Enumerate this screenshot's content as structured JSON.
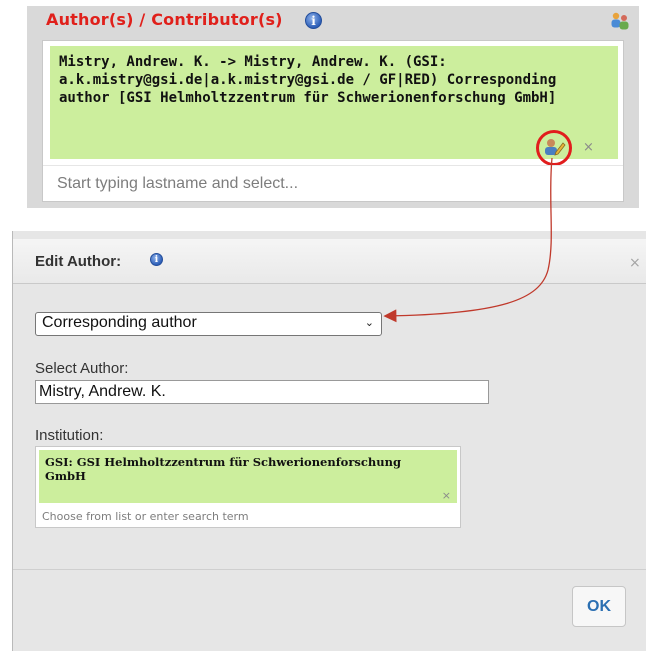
{
  "author_section": {
    "title": "Author(s) / Contributor(s)",
    "info_icon": "info-icon",
    "manage_icon": "people-group-icon",
    "selected_author": {
      "text": "Mistry, Andrew. K. -> Mistry, Andrew. K. (GSI: a.k.mistry@gsi.de|a.k.mistry@gsi.de / GF|RED) Corresponding author [GSI Helmholtzzentrum für Schwerionenforschung GmbH]",
      "edit_icon": "edit-author-icon",
      "remove_label": "×"
    },
    "search_placeholder": "Start typing lastname and select..."
  },
  "dialog": {
    "title": "Edit Author:",
    "close_label": "×",
    "role_select": {
      "selected": "Corresponding author",
      "chevron": "⌄"
    },
    "select_author_label": "Select Author:",
    "author_value": "Mistry, Andrew. K.",
    "institution_label": "Institution:",
    "institution_tag": "GSI: GSI Helmholtzzentrum für Schwerionenforschung GmbH",
    "institution_remove": "×",
    "institution_placeholder": "Choose from list or enter search term",
    "ok_label": "OK"
  },
  "colors": {
    "title_red": "#e0201b",
    "tag_green": "#ccee9d",
    "highlight_red": "#e11d1d",
    "ok_blue": "#2b6fb2"
  }
}
